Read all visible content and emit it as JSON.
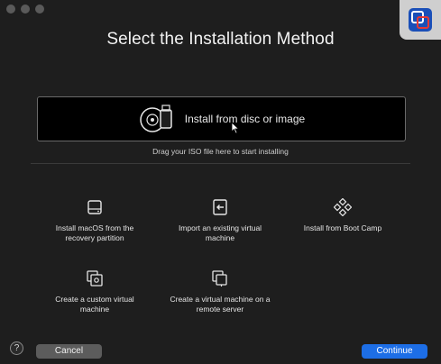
{
  "window": {
    "title": "Select the Installation Method"
  },
  "drop_zone": {
    "label": "Install from disc or image",
    "hint": "Drag your ISO file here to start installing"
  },
  "options": [
    {
      "label": "Install macOS from the recovery partition",
      "icon": "hard-drive-icon"
    },
    {
      "label": "Import an existing virtual machine",
      "icon": "import-icon"
    },
    {
      "label": "Install from Boot Camp",
      "icon": "boot-camp-icon"
    },
    {
      "label": "Create a custom virtual machine",
      "icon": "custom-vm-icon"
    },
    {
      "label": "Create a virtual machine on a remote server",
      "icon": "remote-server-icon"
    }
  ],
  "footer": {
    "help_label": "?",
    "cancel_label": "Cancel",
    "continue_label": "Continue"
  },
  "colors": {
    "background": "#1e1e1e",
    "accent": "#1d6ee6",
    "drop_zone": "#000000"
  }
}
